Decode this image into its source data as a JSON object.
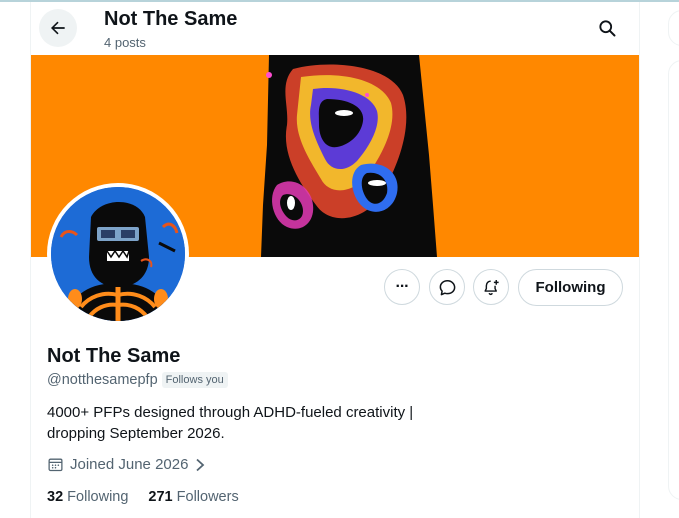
{
  "header": {
    "title": "Not The Same",
    "post_count": "4 posts"
  },
  "actions": {
    "more_label": "···",
    "following_label": "Following"
  },
  "profile": {
    "display_name": "Not The Same",
    "handle": "@notthesamepfp",
    "follows_you": "Follows you",
    "bio_line1": "4000+ PFPs designed through ADHD-fueled creativity |",
    "bio_line2": "dropping September 2026.",
    "joined": "Joined June 2026"
  },
  "stats": {
    "following_count": "32",
    "following_label": "Following",
    "followers_count": "271",
    "followers_label": "Followers"
  },
  "colors": {
    "banner": "#ff8800",
    "avatar_bg": "#1d6bd6",
    "text_primary": "#0f1419",
    "text_secondary": "#536471",
    "border": "#cfd9de"
  },
  "icons": {
    "back": "arrow-left-icon",
    "search": "search-icon",
    "more": "more-dots-icon",
    "message": "message-bubble-icon",
    "notify": "bell-plus-icon",
    "calendar": "calendar-icon",
    "chevron": "chevron-right-icon"
  }
}
